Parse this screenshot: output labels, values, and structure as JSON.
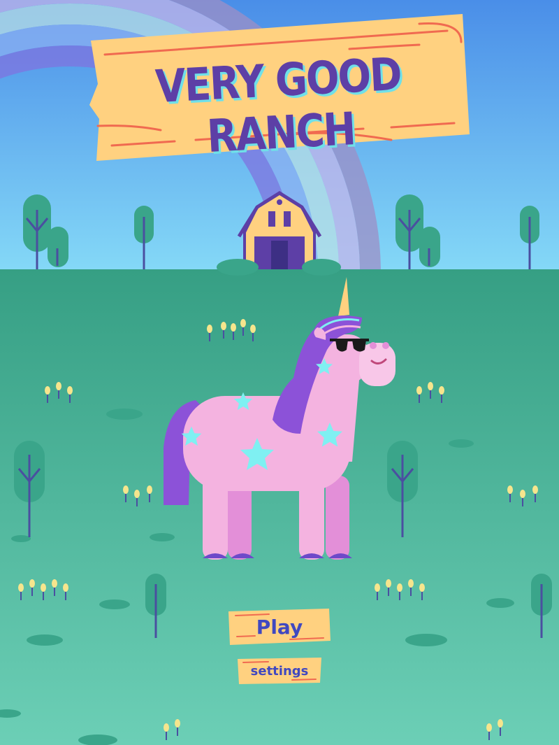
{
  "game": {
    "title": "VERY GOOD RANCH"
  },
  "menu": {
    "play_label": "Play",
    "settings_label": "settings"
  },
  "colors": {
    "sky_top": "#4a8ee8",
    "sky_bottom": "#7fd4f6",
    "grass": "#3aa58a",
    "sign_wood": "#ffd180",
    "sign_accent": "#f06a50",
    "title_purple": "#5d3fa6",
    "unicorn_pink": "#f4b3e0",
    "mane_purple": "#8c52d8",
    "star_cyan": "#7ff0f2",
    "button_text": "#4048c0"
  }
}
